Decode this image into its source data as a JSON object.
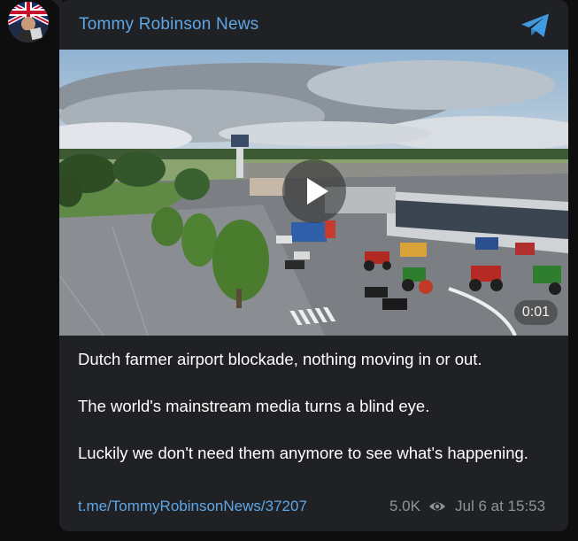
{
  "channel": {
    "name": "Tommy Robinson News",
    "accent": "#5ea6e6"
  },
  "icons": {
    "avatar": "channel-avatar-flag",
    "platform": "telegram-icon",
    "play": "play-icon",
    "views": "eye-icon"
  },
  "video": {
    "duration": "0:01"
  },
  "post": {
    "paragraphs": [
      "Dutch farmer airport blockade, nothing moving in or out.",
      "The world's mainstream media turns a blind eye.",
      "Luckily we don't need them anymore to see what's happening."
    ],
    "link": "t.me/TommyRobinsonNews/37207",
    "views": "5.0K",
    "date": "Jul 6 at 15:53"
  }
}
